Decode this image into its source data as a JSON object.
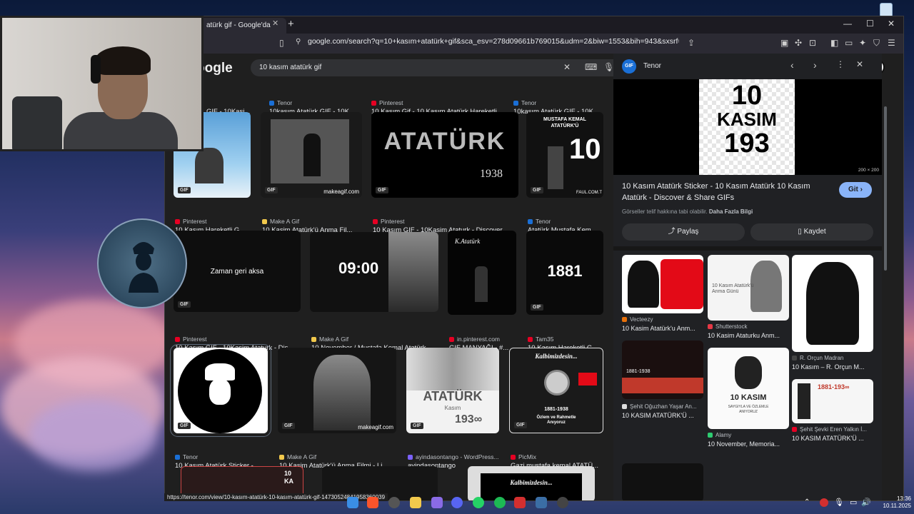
{
  "browser": {
    "tab_title": "10 kasım atatürk gif - Google'da Ara",
    "tab_display": "atürk gif - Google'da",
    "url": "google.com/search?q=10+kasım+atatürk+gif&sca_esv=278d09661b769015&udm=2&biw=1553&bih=943&sxsrf=AE3TifM...",
    "status_url": "https://tenor.com/view/10-kasım-atatürk-10-kasım-atatürk-gif-14730524841958360039"
  },
  "search": {
    "logo": "oogle",
    "query": "10 kasım atatürk gif"
  },
  "top_captions": [
    {
      "title": "GIF - 10Kasi..."
    },
    {
      "source": "Tenor",
      "title": "10kasım Atatürk GIF - 10K..."
    },
    {
      "source": "Pinterest",
      "title": "10 Kasım Gif - 10 Kasım Atatürk Hareketli"
    },
    {
      "source": "Tenor",
      "title": "10kasım Atatürk GIF - 10K..."
    }
  ],
  "results": [
    {
      "source": "Pinterest",
      "title": "10 Kasım Hareketli G...",
      "gif": "GIF",
      "text": ""
    },
    {
      "source": "Make A Gif",
      "title": "10 Kasim Atatürk'ü Anma Fil...",
      "gif": "GIF",
      "text": "makeagif.com"
    },
    {
      "source": "Pinterest",
      "title": "10 Kasım GIF - 10Kasim Ataturk - Discover ...",
      "gif": "GIF",
      "text": "ATATÜRK",
      "text2": "1938"
    },
    {
      "source": "Tenor",
      "title": "Atatürk Mustafa Kem...",
      "gif": "GIF",
      "text": "MUSTAFA KEMAL ATATÜRK'Ü",
      "text2": "10",
      "text3": "FAUL.COM.T"
    },
    {
      "source": "Pinterest",
      "title": "10 Kasım GIF - 10Kasim Ataturk - Dis...",
      "gif": "GIF",
      "text": "Zaman geri aksa"
    },
    {
      "source": "Make A Gif",
      "title": "10 November / Mustafa Kemal Atatürk...",
      "gif": "",
      "text": "09:00"
    },
    {
      "source": "in.pinterest.com",
      "title": "GIF MANYAĞI - #...",
      "gif": "",
      "text": "K.Atatürk"
    },
    {
      "source": "Tam35",
      "title": "10 Kasım Hareketli G...",
      "gif": "GIF",
      "text": "1881"
    },
    {
      "source": "Tenor",
      "title": "10 Kasım Atatürk Sticker - ...",
      "gif": "GIF",
      "text": ""
    },
    {
      "source": "Make A Gif",
      "title": "10 Kasim Atatürk'ü Anma Filmi - Li...",
      "gif": "GIF",
      "text": "makeagif.com"
    },
    {
      "source": "ayindasontango - WordPress...",
      "title": "ayindasontango",
      "gif": "GIF",
      "text": "ATATÜRK",
      "text2": "Kasım",
      "text3": "193∞"
    },
    {
      "source": "PicMix",
      "title": "Gazi mustafa kemal ATATÜ...",
      "gif": "GIF",
      "text": "Kalbimizdesin...",
      "text2": "1881-1938",
      "text3": "Özlem ve Rahmetle Anıyoruz"
    }
  ],
  "bottom_row": [
    {
      "text": "10 KA"
    },
    {
      "text": ""
    },
    {
      "text": "Kalbimizdesin..."
    }
  ],
  "panel": {
    "source": "Tenor",
    "logo": "GIF",
    "img_line1": "10",
    "img_line2": "KASIM",
    "img_line3": "193",
    "size": "200 × 200",
    "title": "10 Kasım Atatürk Sticker - 10 Kasım Atatürk 10 Kasım Atatürk - Discover & Share GIFs",
    "visit_label": "Git",
    "note": "Görseller telif hakkına tabi olabilir.",
    "note_link": "Daha Fazla Bilgi",
    "share_label": "Paylaş",
    "save_label": "Kaydet",
    "related": [
      {
        "source": "Vecteezy",
        "title": "10 Kasim Atatürk'u Anm..."
      },
      {
        "source": "Shutterstock",
        "title": "10 Kasim Ataturku Anm...",
        "text": "10 Kasım Atatürk'ü Anma Günü"
      },
      {
        "source": "R. Orçun Madran",
        "title": "10 Kasım – R. Orçun M..."
      },
      {
        "source": "Şehit Oğuzhan Yaşar An...",
        "title": "10 KASIM ATATÜRK'Ü ...",
        "text": "1881-1938"
      },
      {
        "source": "Alamy",
        "title": "10 November, Memoria...",
        "text": "10 KASIM",
        "text2": "SAYGIYLA VE ÖZLEMLE ANIYORUZ"
      },
      {
        "source": "Şehit Şevki Eren Yalkın İ...",
        "title": "10 KASIM ATATÜRK'Ü ...",
        "text": "1881-193∞"
      }
    ]
  },
  "taskbar": {
    "time": "13:36",
    "date": "10.11.2025"
  },
  "colors": {
    "accent": "#8ab4f8",
    "pinterest": "#e60023",
    "tenor": "#1a6fd6",
    "makeagif": "#f2c94c"
  }
}
